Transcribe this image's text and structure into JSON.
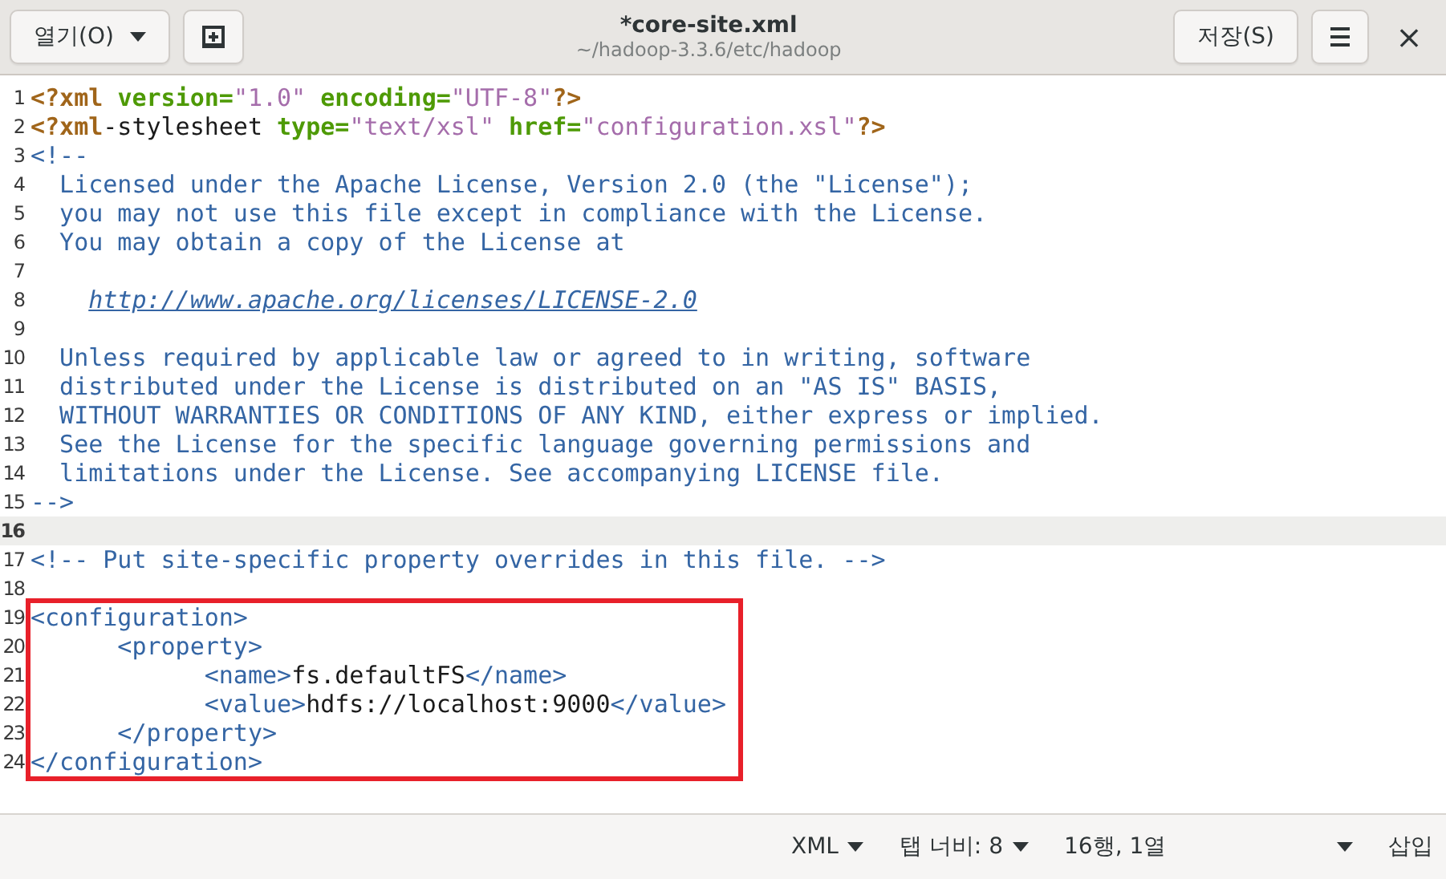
{
  "header": {
    "open_button": "열기(O)",
    "title": "*core-site.xml",
    "subtitle": "~/hadoop-3.3.6/etc/hadoop",
    "save_button": "저장(S)",
    "close": "×"
  },
  "lines": [
    {
      "number": "1",
      "current": false,
      "tokens": [
        {
          "kind": "pi",
          "text": "<?xml "
        },
        {
          "kind": "attr",
          "text": "version="
        },
        {
          "kind": "string",
          "text": "\"1.0\""
        },
        {
          "kind": "attr",
          "text": " encoding="
        },
        {
          "kind": "string",
          "text": "\"UTF-8\""
        },
        {
          "kind": "pi",
          "text": "?>"
        }
      ]
    },
    {
      "number": "2",
      "current": false,
      "tokens": [
        {
          "kind": "pi",
          "text": "<?xml"
        },
        {
          "kind": "text",
          "text": "-stylesheet "
        },
        {
          "kind": "attr",
          "text": "type="
        },
        {
          "kind": "string",
          "text": "\"text/xsl\""
        },
        {
          "kind": "attr",
          "text": " href="
        },
        {
          "kind": "string",
          "text": "\"configuration.xsl\""
        },
        {
          "kind": "pi",
          "text": "?>"
        }
      ]
    },
    {
      "number": "3",
      "current": false,
      "tokens": [
        {
          "kind": "comment",
          "text": "<!--"
        }
      ]
    },
    {
      "number": "4",
      "current": false,
      "tokens": [
        {
          "kind": "comment",
          "text": "  Licensed under the Apache License, Version 2.0 (the \"License\");"
        }
      ]
    },
    {
      "number": "5",
      "current": false,
      "tokens": [
        {
          "kind": "comment",
          "text": "  you may not use this file except in compliance with the License."
        }
      ]
    },
    {
      "number": "6",
      "current": false,
      "tokens": [
        {
          "kind": "comment",
          "text": "  You may obtain a copy of the License at"
        }
      ]
    },
    {
      "number": "7",
      "current": false
    },
    {
      "number": "8",
      "current": false,
      "tokens": [
        {
          "kind": "link",
          "text": "http://www.apache.org/licenses/LICENSE-2.0"
        }
      ]
    },
    {
      "number": "9",
      "current": false
    },
    {
      "number": "10",
      "current": false,
      "tokens": [
        {
          "kind": "comment",
          "text": "  Unless required by applicable law or agreed to in writing, software"
        }
      ]
    },
    {
      "number": "11",
      "current": false,
      "tokens": [
        {
          "kind": "comment",
          "text": "  distributed under the License is distributed on an \"AS IS\" BASIS,"
        }
      ]
    },
    {
      "number": "12",
      "current": false,
      "tokens": [
        {
          "kind": "comment",
          "text": "  WITHOUT WARRANTIES OR CONDITIONS OF ANY KIND, either express or implied."
        }
      ]
    },
    {
      "number": "13",
      "current": false,
      "tokens": [
        {
          "kind": "comment",
          "text": "  See the License for the specific language governing permissions and"
        }
      ]
    },
    {
      "number": "14",
      "current": false,
      "tokens": [
        {
          "kind": "comment",
          "text": "  limitations under the License. See accompanying LICENSE file."
        }
      ]
    },
    {
      "number": "15",
      "current": false,
      "tokens": [
        {
          "kind": "comment",
          "text": "-->"
        }
      ]
    },
    {
      "number": "16",
      "current": true
    },
    {
      "number": "17",
      "current": false,
      "tokens": [
        {
          "kind": "comment",
          "text": "<!-- Put site-specific property overrides in this file. -->"
        }
      ]
    },
    {
      "number": "18",
      "current": false
    }
  ],
  "boxed_lines": [
    {
      "number": "19",
      "current": false,
      "tokens": [
        {
          "kind": "tag",
          "text": "<configuration>"
        }
      ]
    },
    {
      "number": "20",
      "current": false,
      "tokens": [
        {
          "kind": "tag",
          "text": "      <property>"
        }
      ]
    },
    {
      "number": "21",
      "current": false,
      "tokens": [
        {
          "kind": "tag",
          "text": "            <name>"
        },
        {
          "kind": "text",
          "text": "fs.defaultFS"
        },
        {
          "kind": "tag",
          "text": "</name>"
        }
      ]
    },
    {
      "number": "22",
      "current": false,
      "tokens": [
        {
          "kind": "tag",
          "text": "            <value>"
        },
        {
          "kind": "text",
          "text": "hdfs://localhost:9000"
        },
        {
          "kind": "tag",
          "text": "</value>"
        }
      ]
    },
    {
      "number": "23",
      "current": false,
      "tokens": [
        {
          "kind": "tag",
          "text": "      </property>"
        }
      ]
    },
    {
      "number": "24",
      "current": false,
      "tokens": [
        {
          "kind": "tag",
          "text": "</configuration>"
        }
      ]
    }
  ],
  "status_bar": {
    "language": "XML",
    "tab_width": "탭 너비: 8",
    "position": "16행, 1열",
    "mode": "삽입"
  }
}
